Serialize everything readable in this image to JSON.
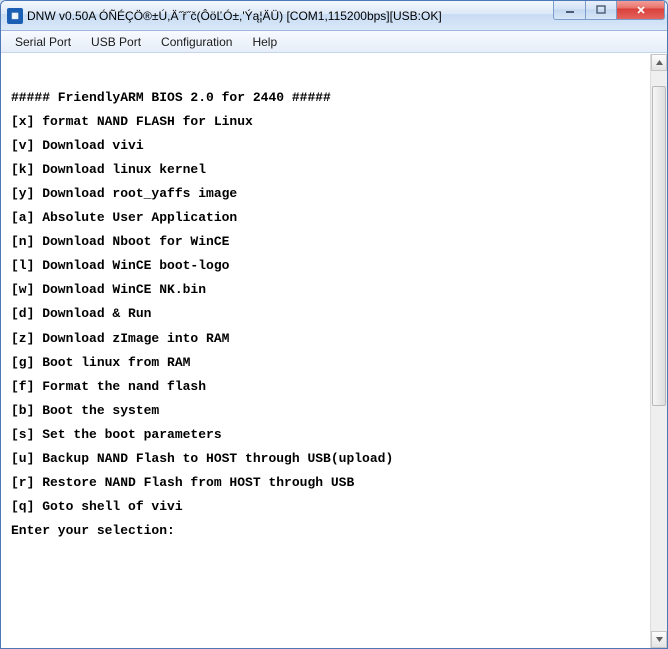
{
  "window": {
    "title": "DNW v0.50A ÓÑÉÇÖ®±Ú,Ä˝ř˝č(ÔöĽÓ±,'Ýą¦ÄÜ)   [COM1,115200bps][USB:OK]"
  },
  "menu": {
    "serial_port": "Serial Port",
    "usb_port": "USB Port",
    "configuration": "Configuration",
    "help": "Help"
  },
  "terminal": {
    "lines": [
      "",
      "##### FriendlyARM BIOS 2.0 for 2440 #####",
      "",
      "[x] format NAND FLASH for Linux",
      "",
      "[v] Download vivi",
      "",
      "[k] Download linux kernel",
      "",
      "[y] Download root_yaffs image",
      "",
      "[a] Absolute User Application",
      "",
      "[n] Download Nboot for WinCE",
      "",
      "[l] Download WinCE boot-logo",
      "",
      "[w] Download WinCE NK.bin",
      "",
      "[d] Download & Run",
      "",
      "[z] Download zImage into RAM",
      "",
      "[g] Boot linux from RAM",
      "",
      "[f] Format the nand flash",
      "",
      "[b] Boot the system",
      "",
      "[s] Set the boot parameters",
      "",
      "[u] Backup NAND Flash to HOST through USB(upload)",
      "",
      "[r] Restore NAND Flash from HOST through USB",
      "",
      "[q] Goto shell of vivi",
      "",
      "Enter your selection:"
    ]
  }
}
